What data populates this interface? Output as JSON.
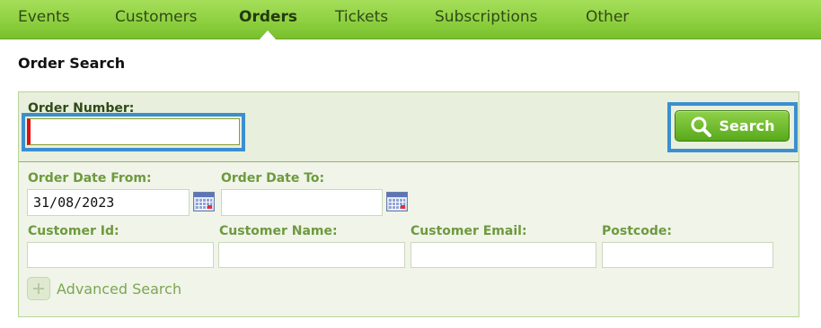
{
  "nav": {
    "tabs": [
      {
        "label": "Events"
      },
      {
        "label": "Customers"
      },
      {
        "label": "Orders",
        "active": true
      },
      {
        "label": "Tickets"
      },
      {
        "label": "Subscriptions"
      },
      {
        "label": "Other"
      }
    ]
  },
  "page": {
    "title": "Order Search"
  },
  "search": {
    "order_number_label": "Order Number:",
    "order_number_value": "",
    "button_label": "Search",
    "icon": "magnifier-icon"
  },
  "filters": {
    "date_from_label": "Order Date From:",
    "date_from_value": "31/08/2023",
    "date_to_label": "Order Date To:",
    "date_to_value": "",
    "customer_id_label": "Customer Id:",
    "customer_name_label": "Customer Name:",
    "customer_email_label": "Customer Email:",
    "postcode_label": "Postcode:",
    "calendar_icon": "calendar-icon"
  },
  "advanced": {
    "label": "Advanced Search",
    "icon": "plus-icon"
  },
  "colors": {
    "nav_green": "#8ccf3e",
    "label_green": "#6e9a3e",
    "highlight_blue": "#3b8fd1",
    "required_red": "#e01010"
  }
}
